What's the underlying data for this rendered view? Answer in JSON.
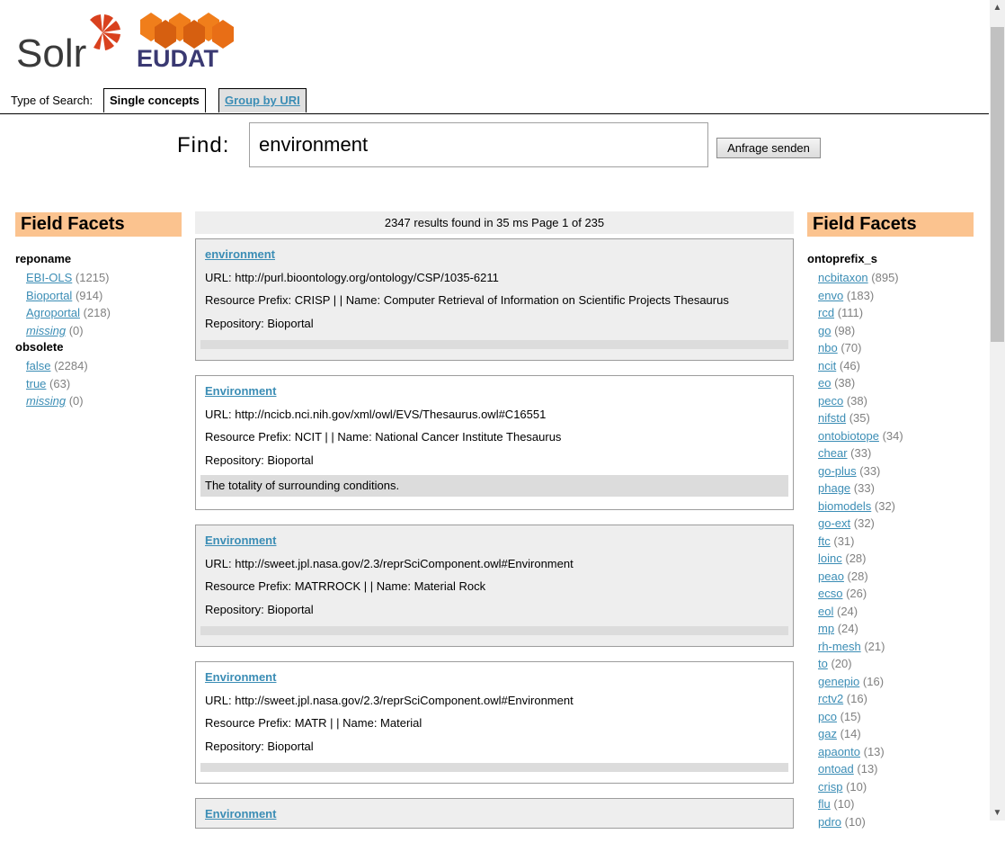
{
  "header": {
    "solr_logo_text": "Solr",
    "eudat_logo_text": "EUDAT",
    "brand_colors": {
      "solr_red": "#d9411e",
      "eudat_orange": "#f07e1b",
      "eudat_navy": "#3a3972"
    }
  },
  "tabs": {
    "label": "Type of Search:",
    "single": "Single concepts",
    "group": "Group by URI"
  },
  "search": {
    "label": "Find:",
    "value": "environment",
    "button": "Anfrage senden"
  },
  "facets_left": {
    "heading": "Field Facets",
    "groups": [
      {
        "title": "reponame",
        "items": [
          {
            "name": "EBI-OLS",
            "count": "(1215)",
            "missing": false
          },
          {
            "name": "Bioportal",
            "count": "(914)",
            "missing": false
          },
          {
            "name": "Agroportal",
            "count": "(218)",
            "missing": false
          },
          {
            "name": "missing",
            "count": "(0)",
            "missing": true
          }
        ]
      },
      {
        "title": "obsolete",
        "items": [
          {
            "name": "false",
            "count": "(2284)",
            "missing": false
          },
          {
            "name": "true",
            "count": "(63)",
            "missing": false
          },
          {
            "name": "missing",
            "count": "(0)",
            "missing": true
          }
        ]
      }
    ]
  },
  "facets_right": {
    "heading": "Field Facets",
    "group_title": "ontoprefix_s",
    "items": [
      {
        "name": "ncbitaxon",
        "count": "(895)"
      },
      {
        "name": "envo",
        "count": "(183)"
      },
      {
        "name": "rcd",
        "count": "(111)"
      },
      {
        "name": "go",
        "count": "(98)"
      },
      {
        "name": "nbo",
        "count": "(70)"
      },
      {
        "name": "ncit",
        "count": "(46)"
      },
      {
        "name": "eo",
        "count": "(38)"
      },
      {
        "name": "peco",
        "count": "(38)"
      },
      {
        "name": "nifstd",
        "count": "(35)"
      },
      {
        "name": "ontobiotope",
        "count": "(34)"
      },
      {
        "name": "chear",
        "count": "(33)"
      },
      {
        "name": "go-plus",
        "count": "(33)"
      },
      {
        "name": "phage",
        "count": "(33)"
      },
      {
        "name": "biomodels",
        "count": "(32)"
      },
      {
        "name": "go-ext",
        "count": "(32)"
      },
      {
        "name": "ftc",
        "count": "(31)"
      },
      {
        "name": "loinc",
        "count": "(28)"
      },
      {
        "name": "peao",
        "count": "(28)"
      },
      {
        "name": "ecso",
        "count": "(26)"
      },
      {
        "name": "eol",
        "count": "(24)"
      },
      {
        "name": "mp",
        "count": "(24)"
      },
      {
        "name": "rh-mesh",
        "count": "(21)"
      },
      {
        "name": "to",
        "count": "(20)"
      },
      {
        "name": "genepio",
        "count": "(16)"
      },
      {
        "name": "rctv2",
        "count": "(16)"
      },
      {
        "name": "pco",
        "count": "(15)"
      },
      {
        "name": "gaz",
        "count": "(14)"
      },
      {
        "name": "apaonto",
        "count": "(13)"
      },
      {
        "name": "ontoad",
        "count": "(13)"
      },
      {
        "name": "crisp",
        "count": "(10)"
      },
      {
        "name": "flu",
        "count": "(10)"
      },
      {
        "name": "pdro",
        "count": "(10)"
      }
    ]
  },
  "results_header": "2347 results found in 35 ms Page 1 of 235",
  "results": [
    {
      "title": "environment",
      "url": "URL: http://purl.bioontology.org/ontology/CSP/1035-6211",
      "prefix": "Resource Prefix: CRISP | | Name: Computer Retrieval of Information on Scientific Projects Thesaurus",
      "repo": "Repository: Bioportal",
      "desc": "",
      "shaded": true
    },
    {
      "title": "Environment",
      "url": "URL: http://ncicb.nci.nih.gov/xml/owl/EVS/Thesaurus.owl#C16551",
      "prefix": "Resource Prefix: NCIT | | Name: National Cancer Institute Thesaurus",
      "repo": "Repository: Bioportal",
      "desc": "The totality of surrounding conditions.",
      "shaded": false
    },
    {
      "title": "Environment",
      "url": "URL: http://sweet.jpl.nasa.gov/2.3/reprSciComponent.owl#Environment",
      "prefix": "Resource Prefix: MATRROCK | | Name: Material Rock",
      "repo": "Repository: Bioportal",
      "desc": "",
      "shaded": true
    },
    {
      "title": "Environment",
      "url": "URL: http://sweet.jpl.nasa.gov/2.3/reprSciComponent.owl#Environment",
      "prefix": "Resource Prefix: MATR | | Name: Material",
      "repo": "Repository: Bioportal",
      "desc": "",
      "shaded": false
    },
    {
      "title": "Environment",
      "url": "",
      "prefix": "",
      "repo": "",
      "desc": "",
      "shaded": true
    }
  ]
}
